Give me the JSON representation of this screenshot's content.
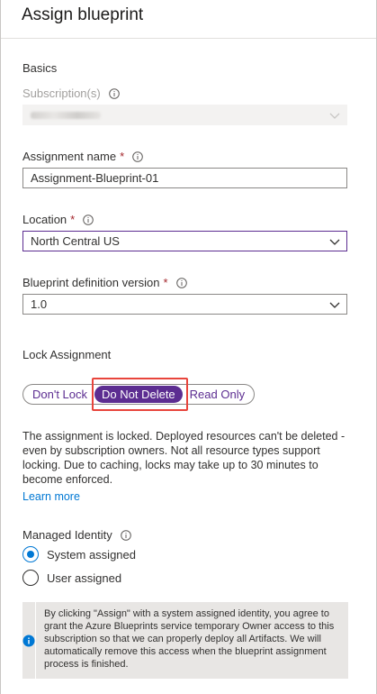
{
  "header": {
    "title": "Assign blueprint"
  },
  "basics": {
    "section_label": "Basics",
    "subscription": {
      "label": "Subscription(s)"
    },
    "assignment_name": {
      "label": "Assignment name",
      "required_mark": "*",
      "value": "Assignment-Blueprint-01"
    },
    "location": {
      "label": "Location",
      "required_mark": "*",
      "value": "North Central US"
    },
    "blueprint_version": {
      "label": "Blueprint definition version",
      "required_mark": "*",
      "value": "1.0"
    }
  },
  "lock": {
    "label": "Lock Assignment",
    "options": [
      "Don't Lock",
      "Do Not Delete",
      "Read Only"
    ],
    "selected": "Do Not Delete",
    "description": "The assignment is locked. Deployed resources can't be deleted - even by subscription owners. Not all resource types support locking. Due to caching, locks may take up to 30 minutes to become enforced.",
    "learn_more": "Learn more"
  },
  "identity": {
    "label": "Managed Identity",
    "options": [
      "System assigned",
      "User assigned"
    ],
    "selected": "System assigned",
    "info_text": "By clicking \"Assign\" with a system assigned identity, you agree to grant the Azure Blueprints service temporary Owner access to this subscription so that we can properly deploy all Artifacts. We will automatically remove this access when the blueprint assignment process is finished."
  },
  "colors": {
    "accent": "#5c2d91",
    "link": "#0078d4",
    "required": "#a4262c",
    "highlight": "#e8453c"
  },
  "icons": {
    "info": "info-icon",
    "chevron": "chevron-down-icon",
    "info_filled": "info-filled-icon"
  }
}
